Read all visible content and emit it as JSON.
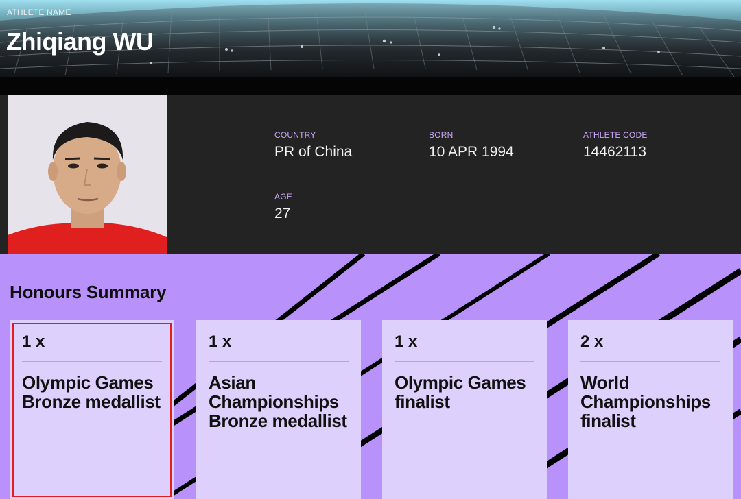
{
  "header": {
    "label": "ATHLETE NAME",
    "name": "Zhiqiang WU"
  },
  "profile": {
    "country_label": "COUNTRY",
    "country": "PR of China",
    "born_label": "BORN",
    "born": "10 APR 1994",
    "code_label": "ATHLETE CODE",
    "code": "14462113",
    "age_label": "AGE",
    "age": "27"
  },
  "honours": {
    "title": "Honours Summary",
    "cards": [
      {
        "count": "1 x",
        "title": "Olympic Games Bronze medallist"
      },
      {
        "count": "1 x",
        "title": "Asian Championships Bronze medallist"
      },
      {
        "count": "1 x",
        "title": "Olympic Games finalist"
      },
      {
        "count": "2 x",
        "title": "World Championships finalist"
      }
    ]
  },
  "colors": {
    "accent_purple": "#b891fb",
    "card_bg": "#ded0fc",
    "label_purple": "#c9a6f7",
    "selection_red": "#e11d1d"
  }
}
